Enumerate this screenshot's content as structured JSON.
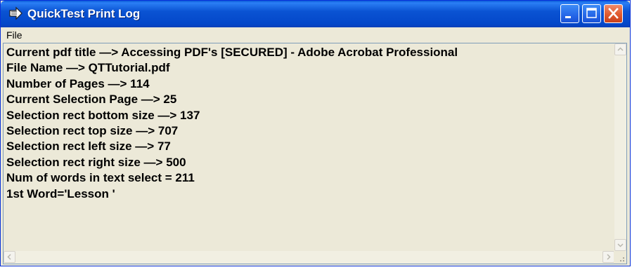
{
  "window": {
    "title": "QuickTest Print Log",
    "icon": "quicktest-app-icon"
  },
  "menu": {
    "file_label": "File"
  },
  "log": {
    "lines": [
      "Current pdf title —> Accessing PDF's [SECURED] - Adobe Acrobat Professional",
      "File Name —> QTTutorial.pdf",
      "Number of Pages —> 114",
      "Current Selection Page —> 25",
      "Selection rect bottom size —> 137",
      "Selection rect top size —> 707",
      "Selection rect left size —> 77",
      "Selection rect right size —> 500",
      "Num of words in text select = 211",
      "1st Word='Lesson '"
    ]
  },
  "colors": {
    "titlebar": "#0a53d3",
    "window_bg": "#ece9d8",
    "close_button": "#e05a2e"
  }
}
